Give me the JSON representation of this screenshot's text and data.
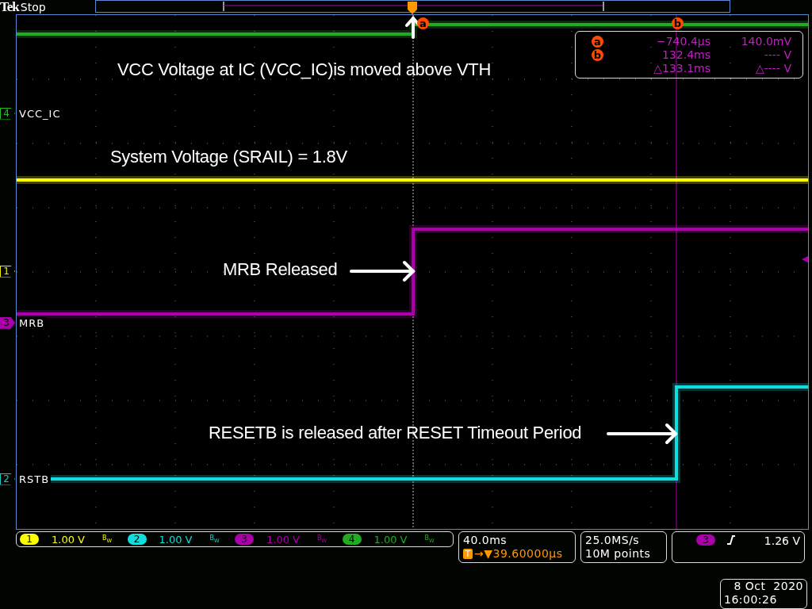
{
  "header": {
    "brand": "Tek",
    "status": "Stop"
  },
  "channel_markers": [
    {
      "number": "4",
      "label": "VCC_IC",
      "color": "#22bb22"
    },
    {
      "number": "1",
      "color": "#eeee00"
    },
    {
      "number": "3",
      "label": "MRB",
      "color": "#aa00aa"
    },
    {
      "number": "2",
      "label": "RSTB",
      "color": "#11cccc"
    }
  ],
  "annotations": [
    {
      "text": "VCC Voltage at IC (VCC_IC)is moved above VTH",
      "kind": "up"
    },
    {
      "text": "System Voltage (SRAIL) = 1.8V",
      "kind": "plain"
    },
    {
      "text": "MRB Released",
      "kind": "right"
    },
    {
      "text": "RESETB is released after RESET Timeout Period",
      "kind": "right"
    }
  ],
  "cursors": [
    {
      "label": "a"
    },
    {
      "label": "b"
    }
  ],
  "cursor_readout": [
    {
      "marker": "a",
      "time": "−740.4µs",
      "value": "140.0mV"
    },
    {
      "marker": "b",
      "time": "132.4ms",
      "value": "---- V"
    },
    {
      "time": "△133.1ms",
      "value": "△---- V"
    }
  ],
  "channels": [
    {
      "number": "1",
      "scale": "1.00 V",
      "bandwidth": "B$_{W}$",
      "color": "#ffff00"
    },
    {
      "number": "2",
      "scale": "1.00 V",
      "bandwidth": "B$_{W}$",
      "color": "#11dddd"
    },
    {
      "number": "3",
      "scale": "1.00 V",
      "bandwidth": "B$_{W}$",
      "color": "#aa00aa"
    },
    {
      "number": "4",
      "scale": "1.00 V",
      "bandwidth": "B$_{W}$",
      "color": "#22aa22"
    }
  ],
  "timebase": {
    "scale": "40.0ms",
    "badge": "T",
    "position": "→▼39.60000µs"
  },
  "acquisition": {
    "sample_rate": "25.0MS/s",
    "record_length": "10M points"
  },
  "trigger": {
    "source": "3",
    "level": "1.26 V"
  },
  "clock": {
    "date": "8 Oct  2020",
    "time": "16:00:26"
  }
}
